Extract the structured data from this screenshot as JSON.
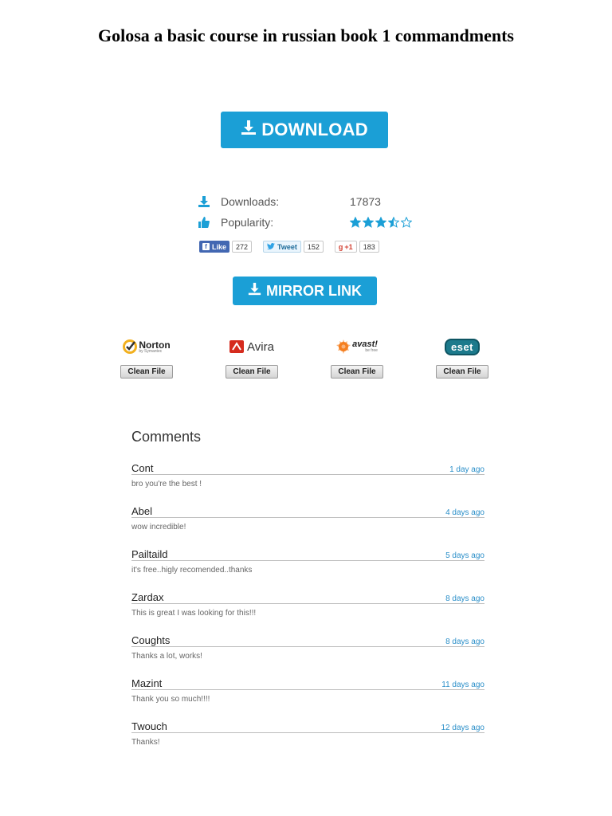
{
  "title": "Golosa a basic course in russian book 1 commandments",
  "download_button": {
    "label": "DOWNLOAD",
    "icon": "download-icon"
  },
  "stats": {
    "downloads_label": "Downloads:",
    "downloads_value": "17873",
    "popularity_label": "Popularity:",
    "popularity_rating": 3.5,
    "popularity_max": 5
  },
  "social": {
    "facebook": {
      "label": "Like",
      "count": "272"
    },
    "twitter": {
      "label": "Tweet",
      "count": "152"
    },
    "google": {
      "label": "+1",
      "count": "183"
    }
  },
  "mirror_button": {
    "label": "MIRROR LINK",
    "icon": "download-icon"
  },
  "antivirus": [
    {
      "name": "Norton",
      "tagline": "by Symantec",
      "button": "Clean File",
      "color": "#f2b01e"
    },
    {
      "name": "Avira",
      "button": "Clean File",
      "color": "#d52b1e"
    },
    {
      "name": "avast!",
      "tagline": "be free",
      "button": "Clean File",
      "color": "#f57f20"
    },
    {
      "name": "eset",
      "button": "Clean File",
      "color": "#1c7a8c"
    }
  ],
  "comments": {
    "title": "Comments",
    "items": [
      {
        "name": "Cont",
        "time": "1 day ago",
        "text": "bro you're the best !"
      },
      {
        "name": "Abel",
        "time": "4 days ago",
        "text": "wow incredible!"
      },
      {
        "name": "Pailtaild",
        "time": "5 days ago",
        "text": "it's free..higly recomended..thanks"
      },
      {
        "name": "Zardax",
        "time": "8 days ago",
        "text": "This is great I was looking for this!!!"
      },
      {
        "name": "Coughts",
        "time": "8 days ago",
        "text": "Thanks a lot, works!"
      },
      {
        "name": "Mazint",
        "time": "11 days ago",
        "text": "Thank you so much!!!!"
      },
      {
        "name": "Twouch",
        "time": "12 days ago",
        "text": "Thanks!"
      }
    ]
  },
  "colors": {
    "accent": "#1b9fd6",
    "link": "#2b8fc9"
  }
}
